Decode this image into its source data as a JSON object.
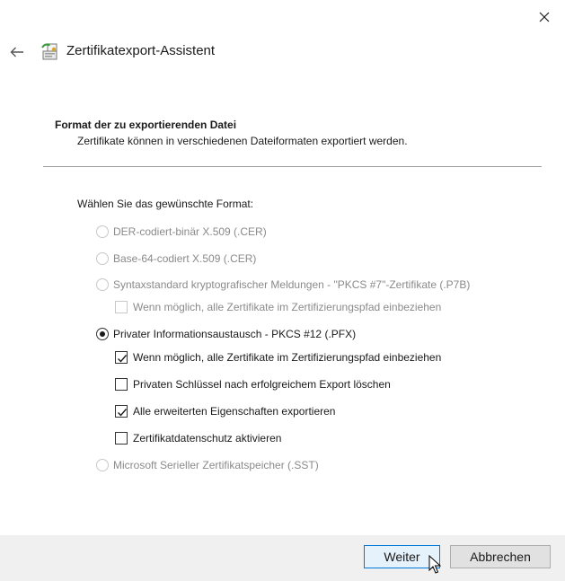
{
  "window": {
    "title": "Zertifikatexport-Assistent"
  },
  "page": {
    "heading": "Format der zu exportierenden Datei",
    "subheading": "Zertifikate können in verschiedenen Dateiformaten exportiert werden.",
    "prompt": "Wählen Sie das gewünschte Format:"
  },
  "formats": {
    "der": {
      "label": "DER-codiert-binär X.509 (.CER)",
      "selected": false,
      "enabled": false
    },
    "base64": {
      "label": "Base-64-codiert X.509 (.CER)",
      "selected": false,
      "enabled": false
    },
    "p7b": {
      "label": "Syntaxstandard kryptografischer Meldungen - \"PKCS #7\"-Zertifikate (.P7B)",
      "selected": false,
      "enabled": false
    },
    "p7b_include_all": {
      "label": "Wenn möglich, alle Zertifikate im Zertifizierungspfad einbeziehen",
      "checked": false,
      "enabled": false
    },
    "pfx": {
      "label": "Privater Informationsaustausch - PKCS #12 (.PFX)",
      "selected": true,
      "enabled": true
    },
    "pfx_include_all": {
      "label": "Wenn möglich, alle Zertifikate im Zertifizierungspfad einbeziehen",
      "checked": true,
      "enabled": true
    },
    "pfx_delete_key": {
      "label": "Privaten Schlüssel nach erfolgreichem Export löschen",
      "checked": false,
      "enabled": true
    },
    "pfx_export_props": {
      "label": "Alle erweiterten Eigenschaften exportieren",
      "checked": true,
      "enabled": true
    },
    "pfx_privacy": {
      "label": "Zertifikatdatenschutz aktivieren",
      "checked": false,
      "enabled": true
    },
    "sst": {
      "label": "Microsoft Serieller Zertifikatspeicher (.SST)",
      "selected": false,
      "enabled": false
    }
  },
  "buttons": {
    "next": "Weiter",
    "cancel": "Abbrechen"
  },
  "icons": {
    "close": "close-icon",
    "back": "back-arrow-icon",
    "wizard": "certificate-wizard-icon",
    "cursor": "mouse-pointer-icon"
  },
  "colors": {
    "accent": "#0078d7",
    "footer": "#f0f0f0",
    "disabled_text": "#8a8a8a"
  }
}
